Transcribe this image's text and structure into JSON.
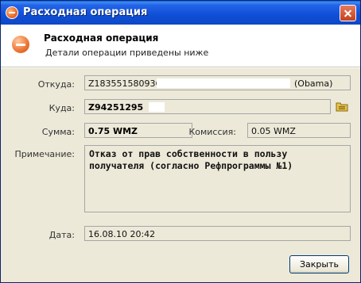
{
  "window": {
    "title": "Расходная операция"
  },
  "header": {
    "title": "Расходная операция",
    "subtitle": "Детали операции приведены ниже"
  },
  "form": {
    "from_label": "Откуда:",
    "from_purse": "Z183551580936,",
    "from_owner": "(Obama)",
    "to_label": "Куда:",
    "to_purse": "Z94251295",
    "amount_label": "Сумма:",
    "amount_value": "0.75 WMZ",
    "fee_label": "Комиссия:",
    "fee_value": "0.05 WMZ",
    "note_label": "Примечание:",
    "note_value": "Отказ от прав собственности в пользу получателя (согласно Рефпрограммы №1)",
    "date_label": "Дата:",
    "date_value": "16.08.10 20:42"
  },
  "buttons": {
    "close": "Закрыть"
  },
  "icons": {
    "title": "minus-circle-icon",
    "header": "minus-circle-icon",
    "browse": "folder-icon"
  }
}
